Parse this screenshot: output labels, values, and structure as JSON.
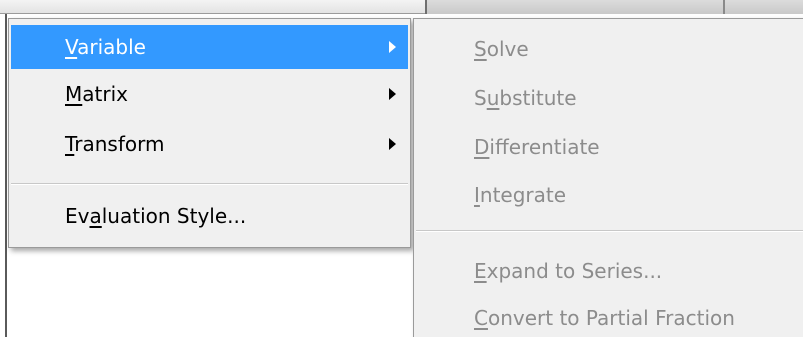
{
  "menu": {
    "items": [
      {
        "pre": "",
        "key": "V",
        "post": "ariable",
        "submenu_arrow": true,
        "highlighted": true
      },
      {
        "pre": "",
        "key": "M",
        "post": "atrix",
        "submenu_arrow": true,
        "highlighted": false
      },
      {
        "pre": "",
        "key": "T",
        "post": "ransform",
        "submenu_arrow": true,
        "highlighted": false
      },
      {
        "pre": "Ev",
        "key": "a",
        "post": "luation Style...",
        "submenu_arrow": false,
        "highlighted": false
      }
    ]
  },
  "submenu": {
    "items": [
      {
        "pre": "",
        "key": "S",
        "post": "olve",
        "enabled": false
      },
      {
        "pre": "S",
        "key": "u",
        "post": "bstitute",
        "enabled": false
      },
      {
        "pre": "",
        "key": "D",
        "post": "ifferentiate",
        "enabled": false
      },
      {
        "pre": "",
        "key": "I",
        "post": "ntegrate",
        "enabled": false
      },
      {
        "pre": "",
        "key": "E",
        "post": "xpand to Series...",
        "enabled": false
      },
      {
        "pre": "",
        "key": "C",
        "post": "onvert to Partial Fraction",
        "enabled": false
      }
    ]
  },
  "colors": {
    "highlight": "#3399ff",
    "menu_background": "#f0f0f0",
    "disabled_text": "#8c8c8c"
  }
}
